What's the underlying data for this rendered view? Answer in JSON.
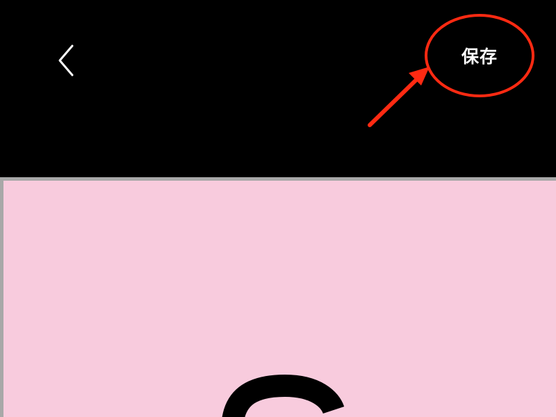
{
  "header": {
    "back_icon": "chevron-left-icon",
    "save_label": "保存"
  },
  "annotation": {
    "highlight_color": "#ff2a12",
    "arrow_icon": "red-arrow-icon"
  },
  "colors": {
    "background": "#000000",
    "canvas_background": "#f8cbdd",
    "canvas_border": "#a8a8a8",
    "text": "#ffffff",
    "shape": "#000000"
  }
}
